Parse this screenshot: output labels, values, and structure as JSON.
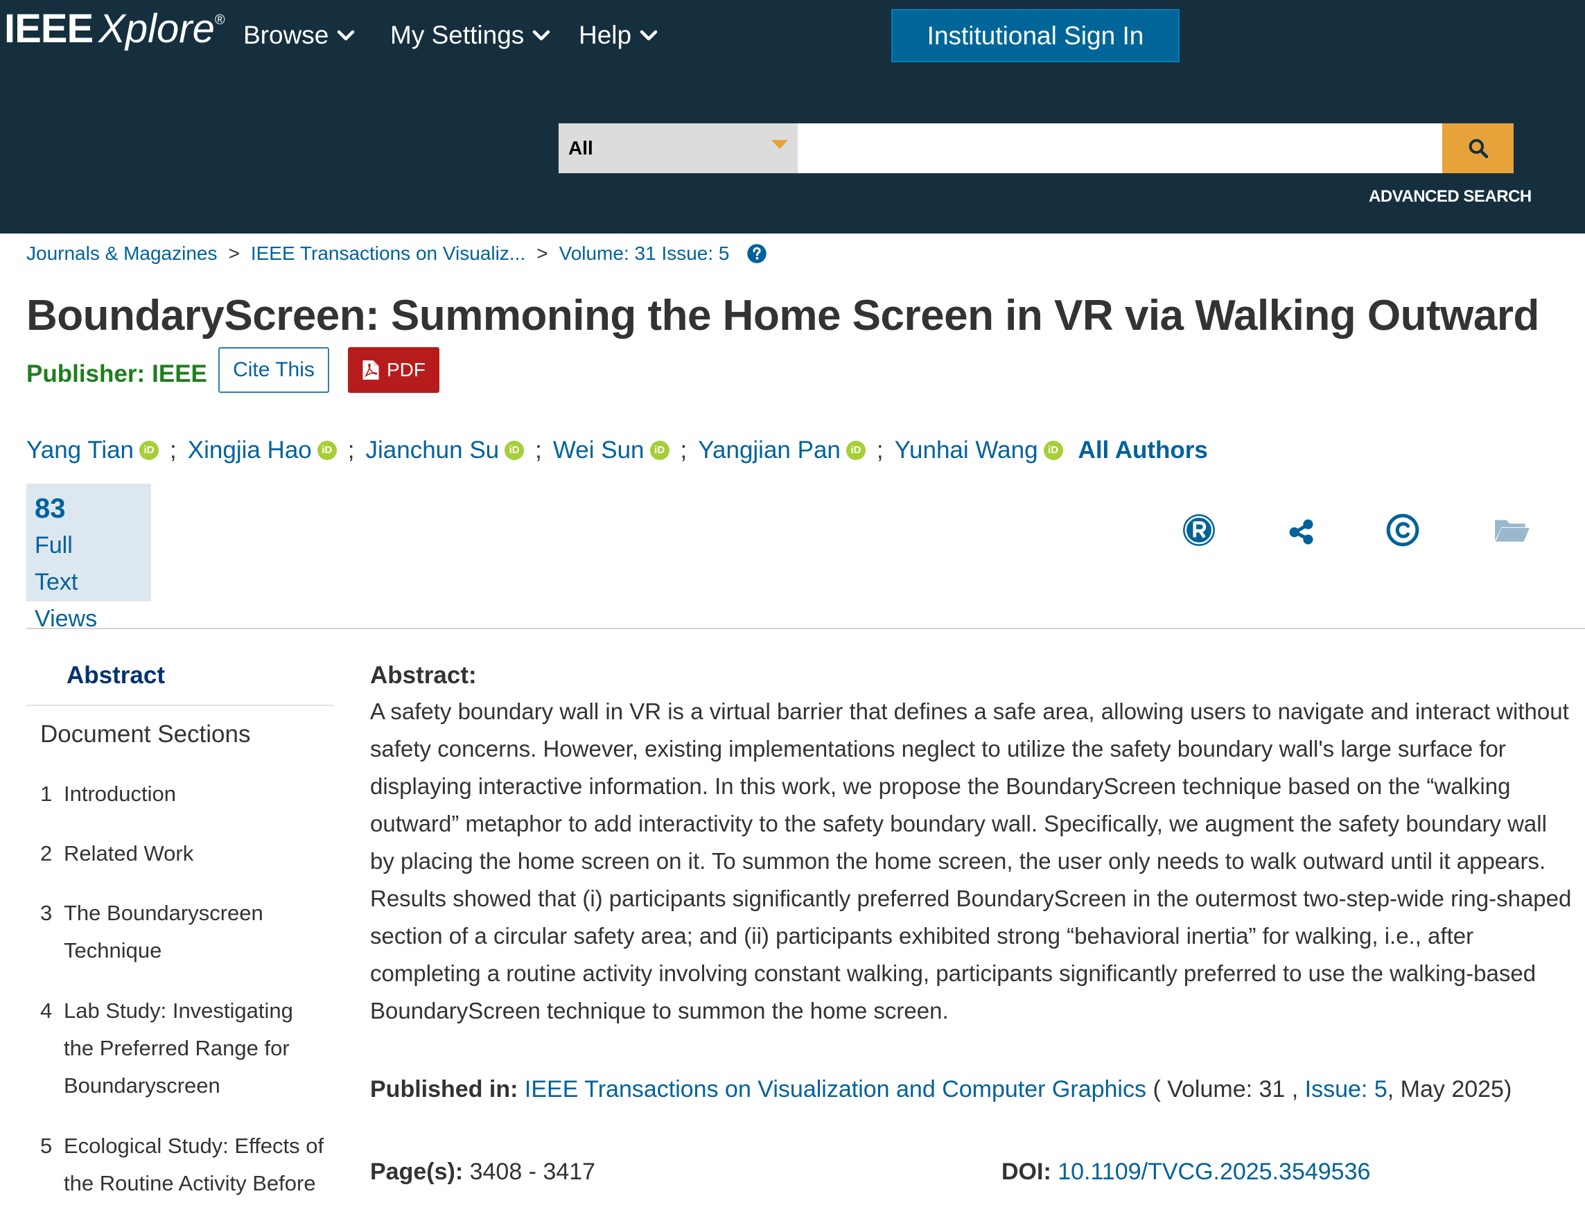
{
  "header": {
    "logo_main": "IEEE",
    "logo_italic": "Xplore",
    "logo_reg": "®",
    "nav": [
      {
        "label": "Browse"
      },
      {
        "label": "My Settings"
      },
      {
        "label": "Help"
      }
    ],
    "signin_label": "Institutional Sign In",
    "search_scope": "All",
    "search_value": "",
    "advanced_search": "ADVANCED SEARCH"
  },
  "breadcrumb": [
    {
      "label": "Journals & Magazines"
    },
    {
      "label": "IEEE Transactions on Visualiz..."
    },
    {
      "label": "Volume: 31 Issue: 5"
    }
  ],
  "article": {
    "title": "BoundaryScreen: Summoning the Home Screen in VR via Walking Outward",
    "publisher_label": "Publisher:",
    "publisher_value": "IEEE",
    "cite_label": "Cite This",
    "pdf_label": "PDF",
    "orcid_glyph": "iD",
    "separator": ";",
    "authors": [
      {
        "name": "Yang Tian"
      },
      {
        "name": "Xingjia Hao"
      },
      {
        "name": "Jianchun Su"
      },
      {
        "name": "Wei Sun"
      },
      {
        "name": "Yangjian Pan"
      },
      {
        "name": "Yunhai Wang"
      }
    ],
    "all_authors": "All Authors",
    "views_count": "83",
    "views_line1": "Full",
    "views_line2": "Text Views"
  },
  "sidebar": {
    "abstract_label": "Abstract",
    "doc_sections_label": "Document Sections",
    "sections": [
      {
        "num": "1",
        "label": "Introduction"
      },
      {
        "num": "2",
        "label": "Related Work"
      },
      {
        "num": "3",
        "label": "The Boundaryscreen Technique"
      },
      {
        "num": "4",
        "label": "Lab Study: Investigating the Preferred Range for Boundaryscreen"
      },
      {
        "num": "5",
        "label": "Ecological Study: Effects of the Routine Activity Before"
      }
    ]
  },
  "abstract": {
    "heading": "Abstract:",
    "lines": [
      "A safety boundary wall in VR is a virtual barrier that defines a safe area, allowing users to navigate and interact without",
      "safety concerns. However, existing implementations neglect to utilize the safety boundary wall's large surface for",
      "displaying interactive information. In this work, we propose the BoundaryScreen technique based on the “walking",
      "outward” metaphor to add interactivity to the safety boundary wall. Specifically, we augment the safety boundary wall",
      "by placing the home screen on it. To summon the home screen, the user only needs to walk outward until it appears.",
      "Results showed that (i) participants significantly preferred BoundaryScreen in the outermost two-step-wide ring-shaped",
      "section of a circular safety area; and (ii) participants exhibited strong “behavioral inertia” for walking, i.e., after",
      "completing a routine activity involving constant walking, participants significantly preferred to use the walking-based",
      "BoundaryScreen technique to summon the home screen."
    ]
  },
  "publication": {
    "published_in_label": "Published in:",
    "journal": "IEEE Transactions on Visualization and Computer Graphics",
    "volume_text": "( Volume: 31 ,",
    "issue_text": "Issue: 5",
    "date_text": ", May 2025)",
    "pages_label": "Page(s):",
    "pages_value": "3408 - 3417",
    "doi_label": "DOI:",
    "doi_value": "10.1109/TVCG.2025.3549536"
  },
  "colors": {
    "header_bg": "#152f3e",
    "link": "#00629b",
    "signin_bg": "#006699",
    "search_btn": "#e7a33a",
    "pdf_red": "#b71c1c",
    "publisher_green": "#1d7e1d",
    "orcid_green": "#a6ce39"
  },
  "icons": [
    "chevron-down-icon",
    "search-icon",
    "help-circle-icon",
    "pdf-file-icon",
    "orcid-icon",
    "rights-r-icon",
    "share-icon",
    "copyright-icon",
    "folder-icon"
  ]
}
